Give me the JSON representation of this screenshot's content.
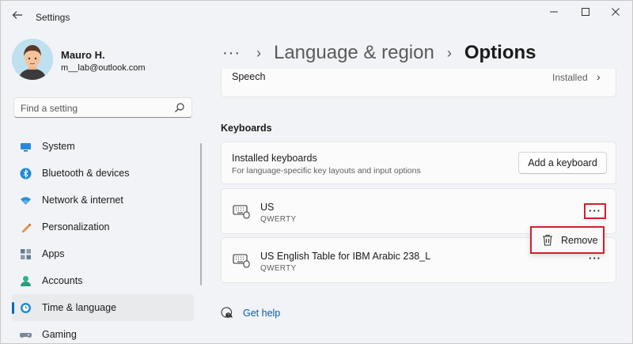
{
  "window": {
    "title": "Settings",
    "controls": {
      "minimize": "—",
      "maximize": "☐",
      "close": "✕"
    }
  },
  "user": {
    "name": "Mauro H.",
    "email": "m__lab@outlook.com"
  },
  "search": {
    "placeholder": "Find a setting"
  },
  "sidebar": {
    "items": [
      {
        "label": "System",
        "icon": "system-icon",
        "active": false
      },
      {
        "label": "Bluetooth & devices",
        "icon": "bluetooth-icon",
        "active": false
      },
      {
        "label": "Network & internet",
        "icon": "network-icon",
        "active": false
      },
      {
        "label": "Personalization",
        "icon": "personalization-icon",
        "active": false
      },
      {
        "label": "Apps",
        "icon": "apps-icon",
        "active": false
      },
      {
        "label": "Accounts",
        "icon": "accounts-icon",
        "active": false
      },
      {
        "label": "Time & language",
        "icon": "time-language-icon",
        "active": true
      },
      {
        "label": "Gaming",
        "icon": "gaming-icon",
        "active": false
      }
    ]
  },
  "breadcrumb": {
    "more": "···",
    "separator": "›",
    "parent": "Language & region",
    "current": "Options"
  },
  "speech": {
    "label": "Speech",
    "status": "Installed",
    "chevron": "›"
  },
  "keyboards": {
    "section_title": "Keyboards",
    "header_title": "Installed keyboards",
    "header_subtitle": "For language-specific key layouts and input options",
    "add_button": "Add a keyboard",
    "more_label": "···",
    "items": [
      {
        "name": "US",
        "layout": "QWERTY"
      },
      {
        "name": "US English Table for IBM Arabic 238_L",
        "layout": "QWERTY"
      }
    ]
  },
  "context_menu": {
    "remove_label": "Remove"
  },
  "help": {
    "label": "Get help"
  },
  "colors": {
    "accent": "#0067c0",
    "highlight": "#d2202a",
    "link": "#0a5cad"
  }
}
